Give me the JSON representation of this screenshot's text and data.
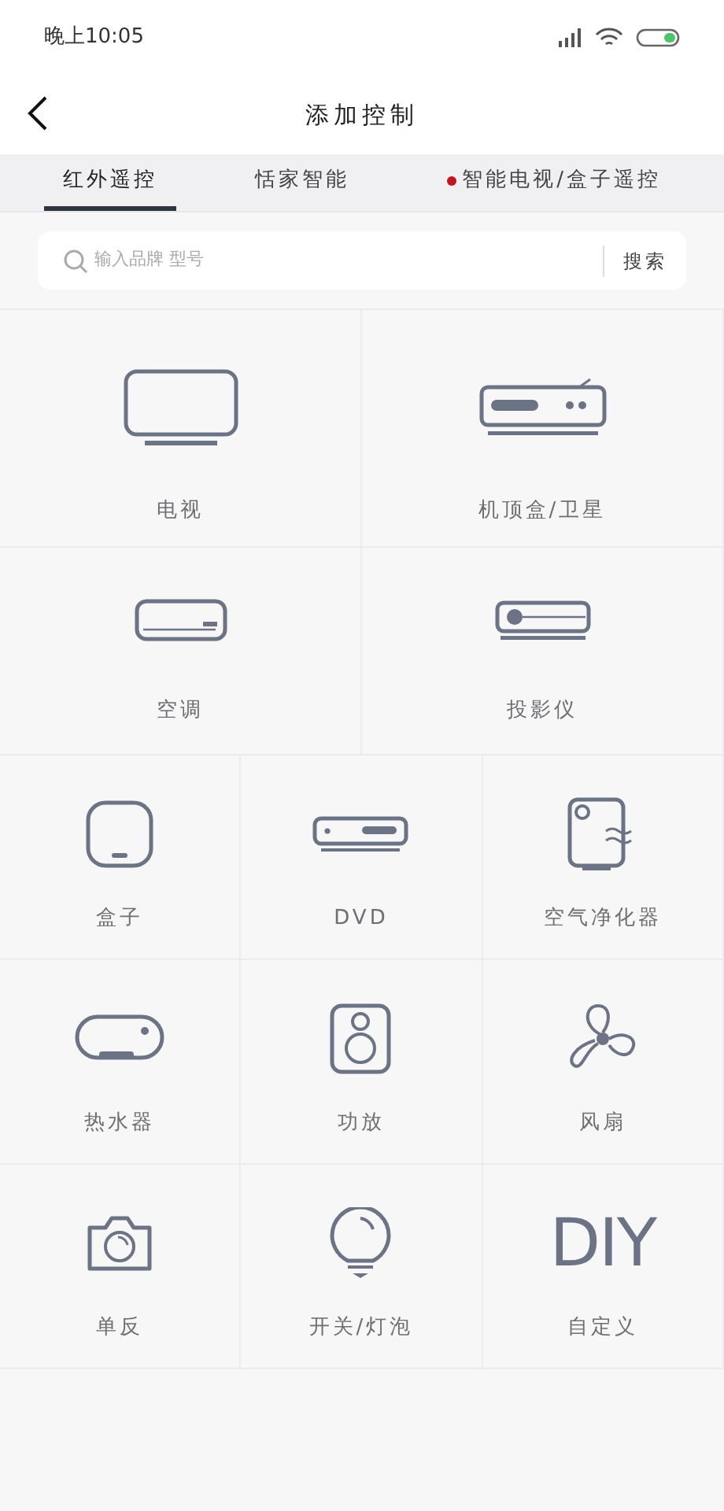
{
  "status_bar": {
    "time": "晚上10:05"
  },
  "header": {
    "title": "添加控制"
  },
  "tabs": [
    {
      "label": "红外遥控",
      "selected": true,
      "badge": false
    },
    {
      "label": "恬家智能",
      "selected": false,
      "badge": false
    },
    {
      "label": "智能电视/盒子遥控",
      "selected": false,
      "badge": true
    }
  ],
  "search": {
    "placeholder": "输入品牌 型号",
    "button": "搜索"
  },
  "large_devices": [
    {
      "kind": "tv",
      "label": "电视"
    },
    {
      "kind": "settop",
      "label": "机顶盒/卫星"
    },
    {
      "kind": "ac",
      "label": "空调"
    },
    {
      "kind": "projector",
      "label": "投影仪"
    }
  ],
  "small_devices": [
    {
      "kind": "box",
      "label": "盒子"
    },
    {
      "kind": "dvd",
      "label": "DVD"
    },
    {
      "kind": "purifier",
      "label": "空气净化器"
    },
    {
      "kind": "heater",
      "label": "热水器"
    },
    {
      "kind": "speaker",
      "label": "功放"
    },
    {
      "kind": "fan",
      "label": "风扇"
    },
    {
      "kind": "camera",
      "label": "单反"
    },
    {
      "kind": "bulb",
      "label": "开关/灯泡"
    },
    {
      "kind": "diy",
      "label": "自定义"
    }
  ],
  "custom_icon_text": "DIY"
}
